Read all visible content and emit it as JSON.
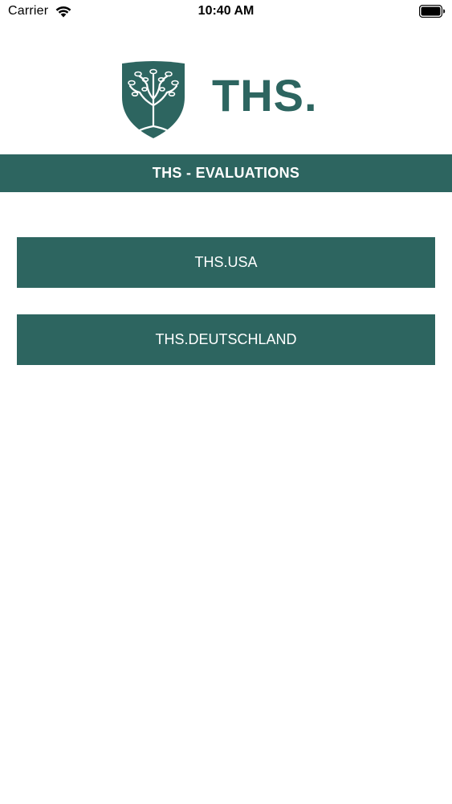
{
  "status_bar": {
    "carrier": "Carrier",
    "time": "10:40 AM"
  },
  "logo": {
    "text": "THS.",
    "icon": "tree-shield-icon",
    "color": "#2d6560"
  },
  "header": {
    "title": "THS - EVALUATIONS"
  },
  "buttons": [
    {
      "label": "THS.USA"
    },
    {
      "label": "THS.DEUTSCHLAND"
    }
  ],
  "colors": {
    "brand": "#2d6560",
    "background": "#ffffff",
    "button_text": "#ffffff"
  }
}
